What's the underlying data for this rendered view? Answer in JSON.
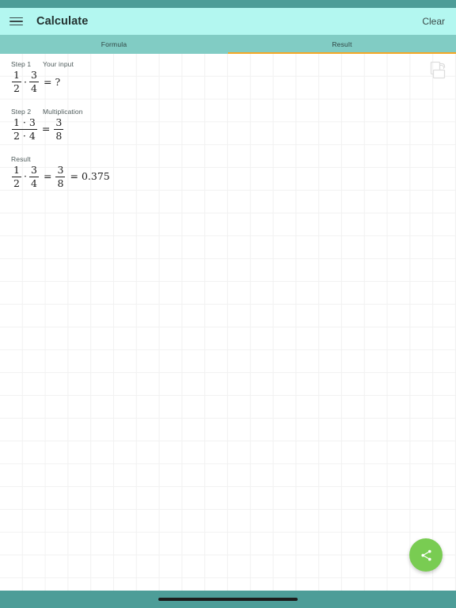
{
  "status_bar": {
    "color": "#4d9d98"
  },
  "app_bar": {
    "color": "#b3f7f0",
    "menu_icon": "hamburger-menu-icon",
    "title": "Calculate",
    "clear_label": "Clear"
  },
  "tabs": {
    "color": "#81ccc4",
    "indicator_color": "#f5a623",
    "active_index": 1,
    "items": [
      {
        "label": "Formula"
      },
      {
        "label": "Result"
      }
    ]
  },
  "content": {
    "copy_icon": "copy-icon",
    "grid_color": "#f1f1f1",
    "steps": [
      {
        "step_label": "Step 1",
        "step_name": "Your input",
        "expression": {
          "parts": [
            {
              "kind": "frac",
              "num": "1",
              "den": "2"
            },
            {
              "kind": "op",
              "text": "·",
              "style": "dot"
            },
            {
              "kind": "frac",
              "num": "3",
              "den": "4"
            },
            {
              "kind": "op",
              "text": "=",
              "style": "eq"
            },
            {
              "kind": "plain",
              "text": "?"
            }
          ]
        }
      },
      {
        "step_label": "Step 2",
        "step_name": "Multiplication",
        "expression": {
          "parts": [
            {
              "kind": "frac",
              "num": "1 · 3",
              "den": "2 · 4"
            },
            {
              "kind": "op",
              "text": "=",
              "style": "eq"
            },
            {
              "kind": "frac",
              "num": "3",
              "den": "8"
            }
          ]
        }
      }
    ],
    "result": {
      "label": "Result",
      "expression": {
        "parts": [
          {
            "kind": "frac",
            "num": "1",
            "den": "2"
          },
          {
            "kind": "op",
            "text": "·",
            "style": "dot"
          },
          {
            "kind": "frac",
            "num": "3",
            "den": "4"
          },
          {
            "kind": "op",
            "text": "=",
            "style": "eq"
          },
          {
            "kind": "frac",
            "num": "3",
            "den": "8"
          },
          {
            "kind": "op",
            "text": "=",
            "style": "eq"
          },
          {
            "kind": "plain",
            "text": "0.375"
          }
        ]
      }
    }
  },
  "fab": {
    "icon": "share-icon",
    "color": "#79cc52"
  },
  "nav_bar": {
    "color": "#4d9d98",
    "home_indicator": "home-indicator-pill"
  }
}
